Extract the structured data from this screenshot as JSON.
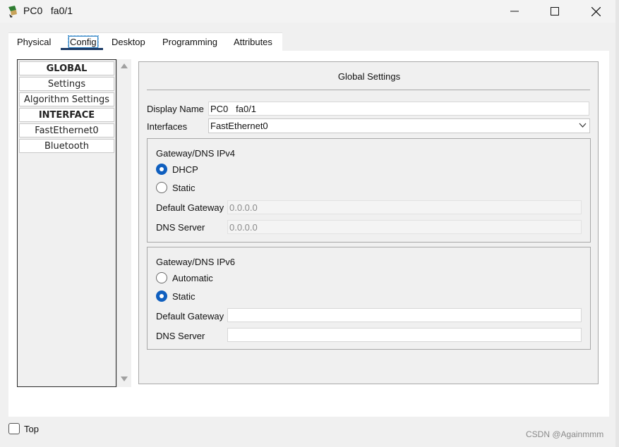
{
  "window": {
    "title": "PC0   fa0/1"
  },
  "tabs": [
    {
      "label": "Physical"
    },
    {
      "label": "Config"
    },
    {
      "label": "Desktop"
    },
    {
      "label": "Programming"
    },
    {
      "label": "Attributes"
    }
  ],
  "active_tab": "Config",
  "sidebar": {
    "items": [
      {
        "label": "GLOBAL",
        "header": true
      },
      {
        "label": "Settings"
      },
      {
        "label": "Algorithm Settings"
      },
      {
        "label": "INTERFACE",
        "header": true
      },
      {
        "label": "FastEthernet0"
      },
      {
        "label": "Bluetooth"
      }
    ]
  },
  "settings": {
    "title": "Global Settings",
    "display_name_label": "Display Name",
    "display_name_value": "PC0   fa0/1",
    "interfaces_label": "Interfaces",
    "interfaces_value": "FastEthernet0",
    "ipv4": {
      "title": "Gateway/DNS IPv4",
      "option_dhcp": "DHCP",
      "option_static": "Static",
      "selected": "DHCP",
      "gateway_label": "Default Gateway",
      "gateway_value": "0.0.0.0",
      "dns_label": "DNS Server",
      "dns_value": "0.0.0.0"
    },
    "ipv6": {
      "title": "Gateway/DNS IPv6",
      "option_auto": "Automatic",
      "option_static": "Static",
      "selected": "Static",
      "gateway_label": "Default Gateway",
      "gateway_value": "",
      "dns_label": "DNS Server",
      "dns_value": ""
    }
  },
  "footer": {
    "top_label": "Top",
    "top_checked": false
  },
  "watermark": "CSDN @Againmmm",
  "colors": {
    "accent": "#0f5fbf",
    "tab_underline": "#1b3a66"
  }
}
